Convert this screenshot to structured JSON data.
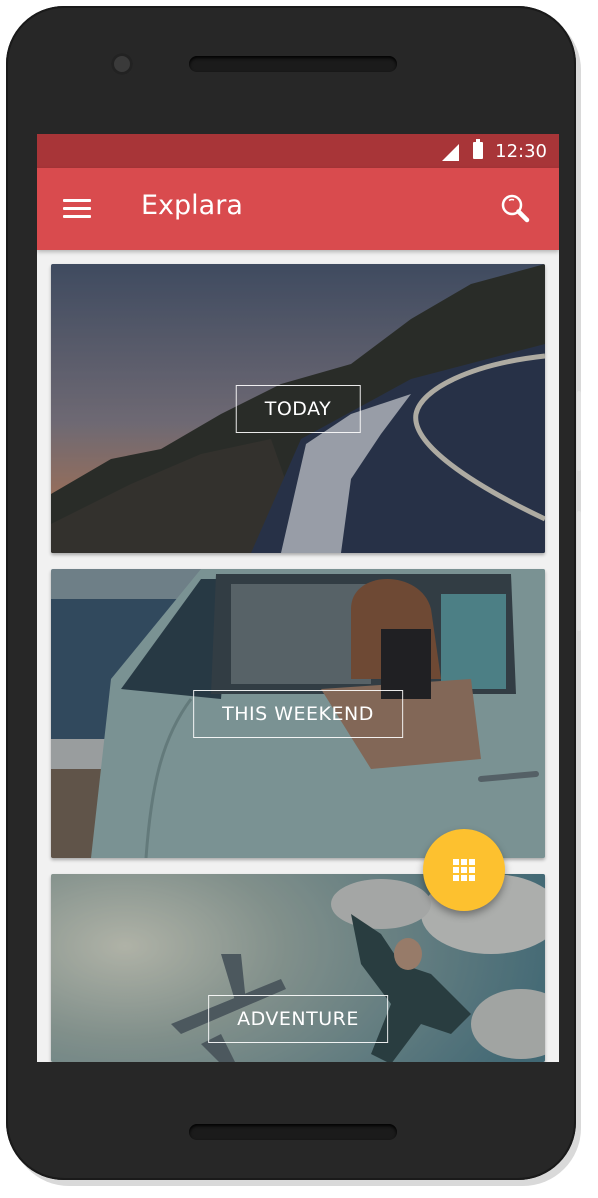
{
  "status_bar": {
    "time": "12:30"
  },
  "app_bar": {
    "title": "Explara",
    "menu_icon": "hamburger-menu-icon",
    "search_icon": "search-icon"
  },
  "cards": [
    {
      "label": "TODAY",
      "image": "coastal road at sunset"
    },
    {
      "label": "THIS WEEKEND",
      "image": "woman leaning out of a camper van by the sea"
    },
    {
      "label": "ADVENTURE",
      "image": "skydiver and airplane in cloudy sky"
    }
  ],
  "fab": {
    "icon": "grid-apps-icon"
  },
  "colors": {
    "status_bar": "#a83538",
    "app_bar": "#d94b4e",
    "fab": "#fdc12f",
    "background": "#f1f1f1"
  }
}
